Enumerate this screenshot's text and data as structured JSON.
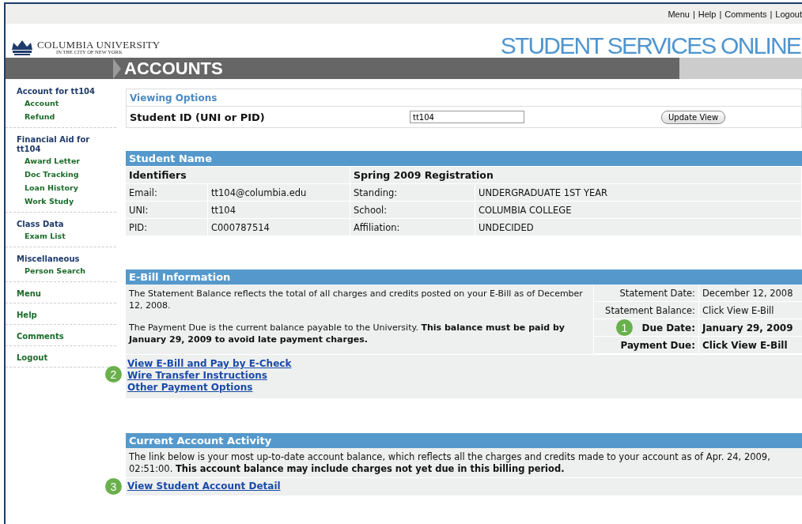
{
  "top_links": {
    "separator": "|",
    "items": [
      "Menu",
      "Help",
      "Comments",
      "Logout"
    ]
  },
  "header": {
    "university": "COLUMBIA UNIVERSITY",
    "tagline": "IN THE CITY OF NEW YORK",
    "site_title": "STUDENT SERVICES ONLINE",
    "section_title": "ACCOUNTS"
  },
  "sidebar": [
    {
      "title": "Account for tt104",
      "items": [
        "Account",
        "Refund"
      ]
    },
    {
      "title": "Financial Aid for tt104",
      "items": [
        "Award Letter",
        "Doc Tracking",
        "Loan History",
        "Work Study"
      ]
    },
    {
      "title": "Class Data",
      "items": [
        "Exam List"
      ]
    },
    {
      "title": "Miscellaneous",
      "items": [
        "Person Search"
      ]
    },
    {
      "title": "Menu"
    },
    {
      "title": "Help"
    },
    {
      "title": "Comments"
    },
    {
      "title": "Logout"
    }
  ],
  "viewing_options": {
    "title": "Viewing Options",
    "label": "Student ID (UNI or PID)",
    "value": "tt104",
    "button": "Update View"
  },
  "student": {
    "title": "Student Name",
    "left_heading": "Identifiers",
    "right_heading": "Spring 2009 Registration",
    "rows": [
      {
        "label": "Email:",
        "value": "tt104@columbia.edu",
        "label_2": "Standing:",
        "value_2": "UNDERGRADUATE 1ST YEAR"
      },
      {
        "label": "UNI:",
        "value": "tt104",
        "label_2": "School:",
        "value_2": "COLUMBIA COLLEGE"
      },
      {
        "label": "PID:",
        "value": "C000787514",
        "label_2": "Affiliation:",
        "value_2": "UNDECIDED"
      }
    ]
  },
  "ebill": {
    "title": "E-Bill Information",
    "paragraphs": [
      "The Statement Balance reflects the total of all charges and credits posted on your E-Bill as of December 12, 2008.",
      "The Payment Due is the current balance payable to the University. **This balance must be paid by January 29, 2009 to avoid late payment charges.**"
    ],
    "facts": [
      {
        "label": "Statement Date:",
        "value": "December 12, 2008",
        "bold": false
      },
      {
        "label": "Statement Balance:",
        "value": "Click View E-Bill",
        "bold": false
      },
      {
        "label": "Due Date:",
        "value": "January 29, 2009",
        "bold": true,
        "callout": "1"
      },
      {
        "label": "Payment Due:",
        "value": "Click View E-Bill",
        "bold": true
      }
    ],
    "links": [
      "View E-Bill and Pay by E-Check",
      "Wire Transfer Instructions",
      "Other Payment Options"
    ],
    "links_callout": "2"
  },
  "activity": {
    "title": "Current Account Activity",
    "text": "The link below is your most up-to-date account balance, which reflects all the charges and credits made to your account as of Apr. 24, 2009, 02:51:00. **This account balance may include charges not yet due in this billing period.**",
    "link": "View Student Account Detail",
    "link_callout": "3"
  }
}
